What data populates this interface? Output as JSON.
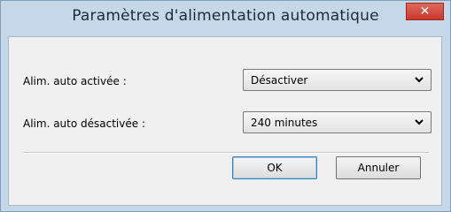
{
  "window": {
    "title": "Paramètres d'alimentation automatique",
    "close_glyph": "✕"
  },
  "form": {
    "power_on_label": "Alim. auto activée :",
    "power_on_value": "Désactiver",
    "power_off_label": "Alim. auto désactivée :",
    "power_off_value": "240 minutes"
  },
  "buttons": {
    "ok_label": "OK",
    "cancel_label": "Annuler"
  },
  "icons": {
    "dropdown": "chevron-down-icon",
    "close": "close-icon"
  },
  "colors": {
    "frame": "#c4d8ea",
    "close": "#c8382c",
    "client": "#f0f0f0"
  }
}
